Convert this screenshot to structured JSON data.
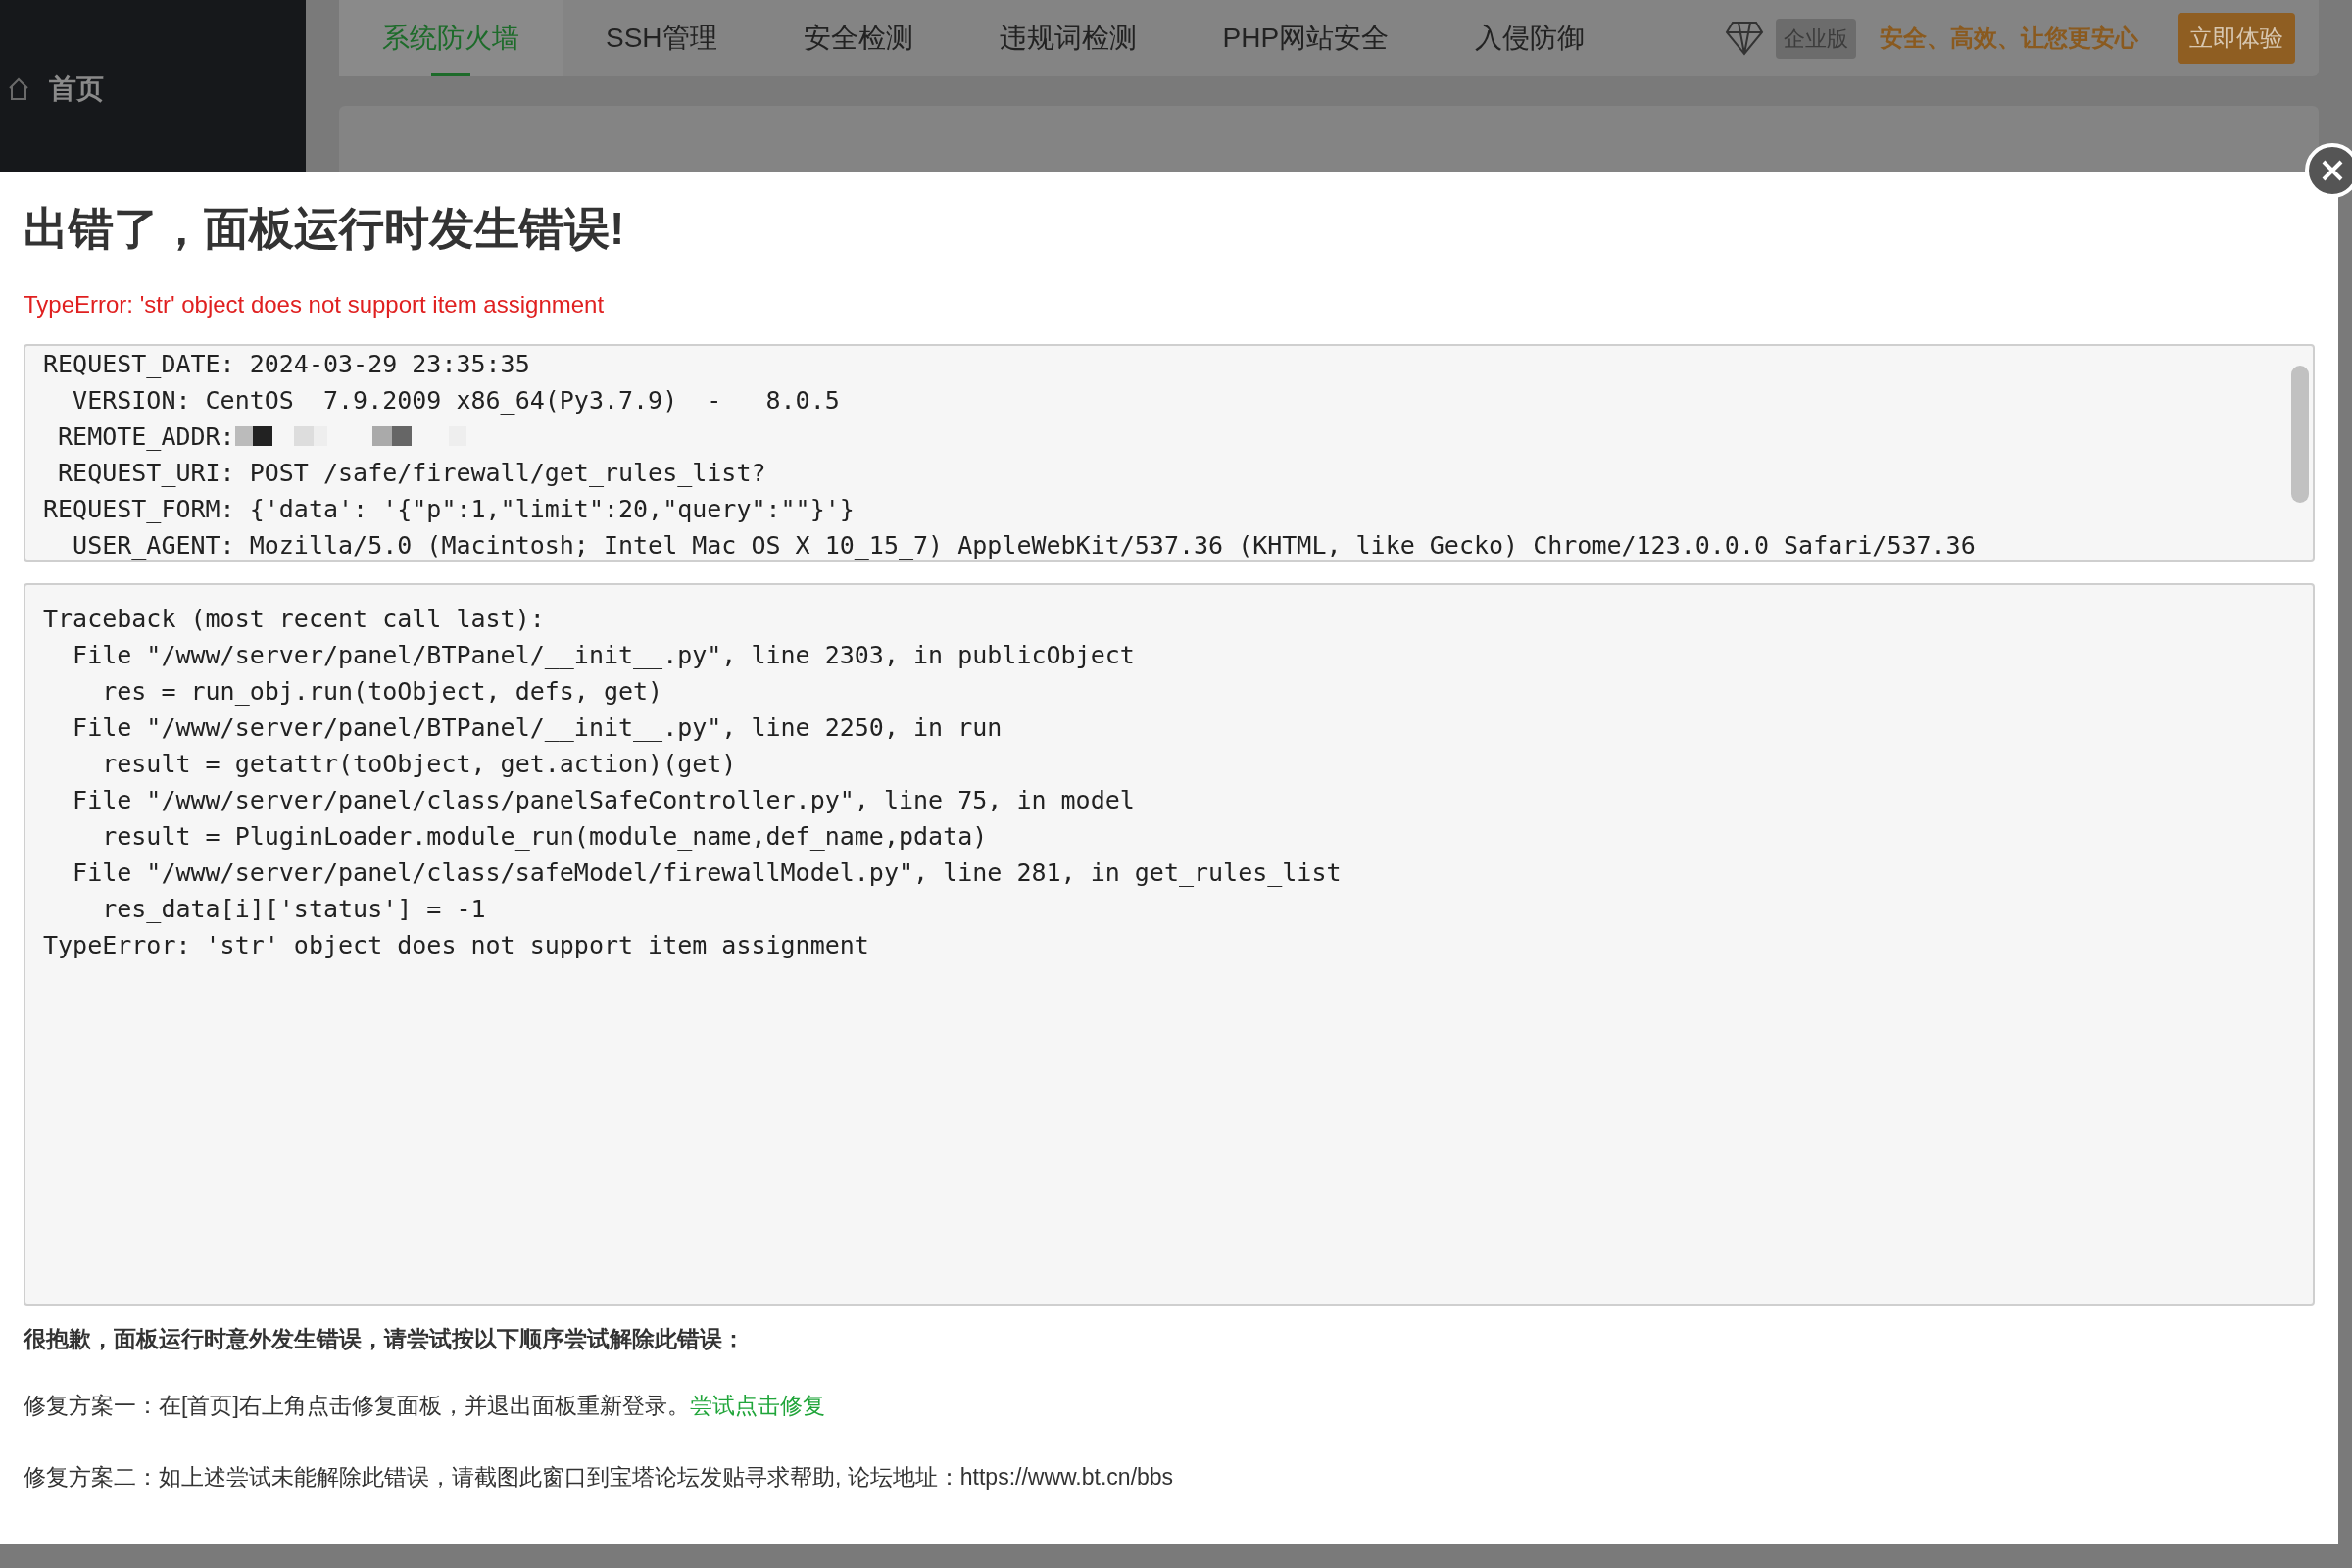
{
  "sidebar": {
    "items": [
      {
        "label": "首页",
        "selected": false
      }
    ]
  },
  "tabs": [
    {
      "label": "系统防火墙",
      "selected": true
    },
    {
      "label": "SSH管理",
      "selected": false
    },
    {
      "label": "安全检测",
      "selected": false
    },
    {
      "label": "违规词检测",
      "selected": false
    },
    {
      "label": "PHP网站安全",
      "selected": false
    },
    {
      "label": "入侵防御",
      "selected": false
    }
  ],
  "promo": {
    "badge": "企业版",
    "slogan": "安全、高效、让您更安心",
    "button": "立即体验"
  },
  "dialog": {
    "title": "出错了，面板运行时发生错误!",
    "error": "TypeError: 'str' object does not support item assignment",
    "request_lines": [
      {
        "kind": "text",
        "text": "REQUEST_DATE: 2024-03-29 23:35:35"
      },
      {
        "kind": "text",
        "text": "  VERSION: CentOS  7.9.2009 x86_64(Py3.7.9)  -   8.0.5"
      },
      {
        "kind": "masked",
        "text": " REMOTE_ADDR:"
      },
      {
        "kind": "text",
        "text": " REQUEST_URI: POST /safe/firewall/get_rules_list?"
      },
      {
        "kind": "text",
        "text": "REQUEST_FORM: {'data': '{\"p\":1,\"limit\":20,\"query\":\"\"}'}"
      },
      {
        "kind": "text",
        "text": "  USER_AGENT: Mozilla/5.0 (Macintosh; Intel Mac OS X 10_15_7) AppleWebKit/537.36 (KHTML, like Gecko) Chrome/123.0.0.0 Safari/537.36"
      }
    ],
    "traceback": [
      "Traceback (most recent call last):",
      "  File \"/www/server/panel/BTPanel/__init__.py\", line 2303, in publicObject",
      "    res = run_obj.run(toObject, defs, get)",
      "  File \"/www/server/panel/BTPanel/__init__.py\", line 2250, in run",
      "    result = getattr(toObject, get.action)(get)",
      "  File \"/www/server/panel/class/panelSafeController.py\", line 75, in model",
      "    result = PluginLoader.module_run(module_name,def_name,pdata)",
      "  File \"/www/server/panel/class/safeModel/firewallModel.py\", line 281, in get_rules_list",
      "    res_data[i]['status'] = -1",
      "TypeError: 'str' object does not support item assignment"
    ],
    "intro": "很抱歉，面板运行时意外发生错误，请尝试按以下顺序尝试解除此错误：",
    "fix_one": {
      "text": "修复方案一：在[首页]右上角点击修复面板，并退出面板重新登录。",
      "link": "尝试点击修复"
    },
    "fix_two": "修复方案二：如上述尝试未能解除此错误，请截图此窗口到宝塔论坛发贴寻求帮助, 论坛地址：https://www.bt.cn/bbs"
  }
}
